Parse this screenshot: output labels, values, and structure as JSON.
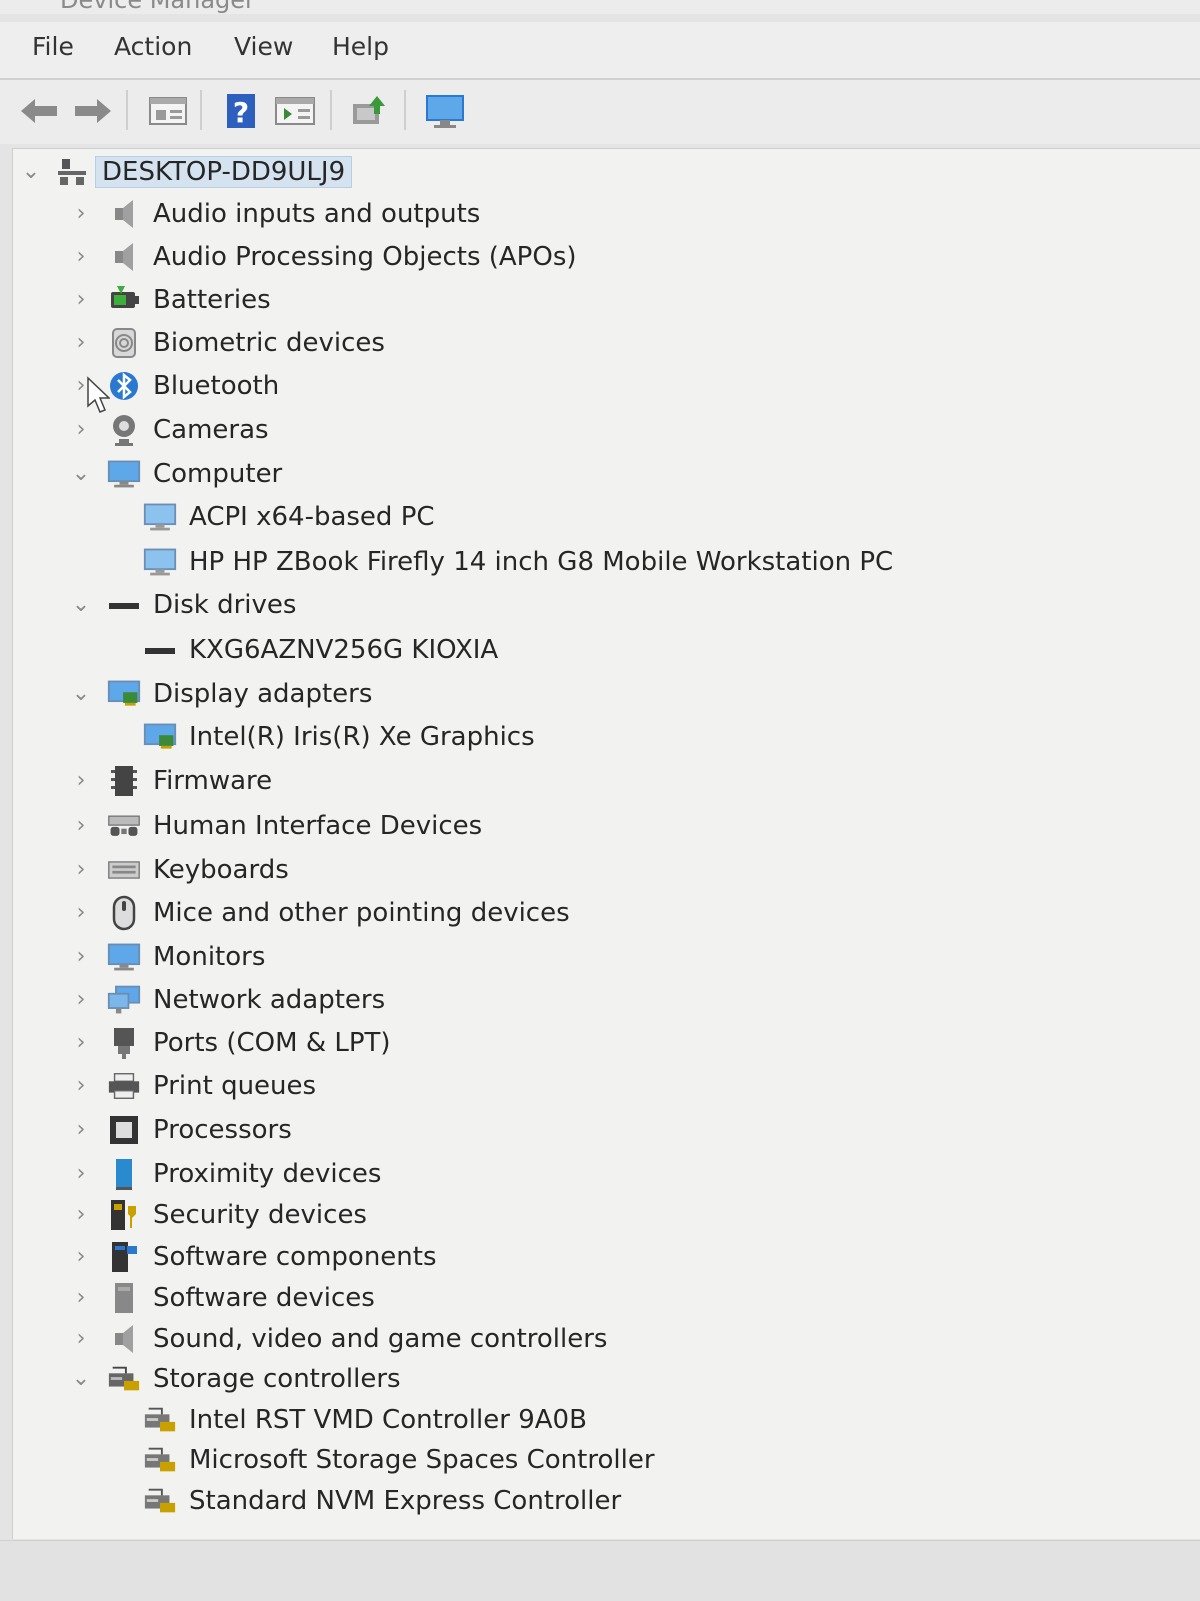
{
  "window": {
    "title": "Device Manager"
  },
  "menu": {
    "file": "File",
    "action": "Action",
    "view": "View",
    "help": "Help"
  },
  "toolbar": {
    "buttons": [
      "back-arrow-icon",
      "forward-arrow-icon",
      "properties-icon",
      "help-icon",
      "view-icon",
      "update-driver-icon",
      "monitor-icon"
    ]
  },
  "tree": {
    "root": "DESKTOP-DD9ULJ9",
    "categories": [
      {
        "label": "Audio inputs and outputs",
        "expanded": false,
        "icon": "speaker-icon"
      },
      {
        "label": "Audio Processing Objects (APOs)",
        "expanded": false,
        "icon": "speaker-icon"
      },
      {
        "label": "Batteries",
        "expanded": false,
        "icon": "battery-icon"
      },
      {
        "label": "Biometric devices",
        "expanded": false,
        "icon": "fingerprint-icon"
      },
      {
        "label": "Bluetooth",
        "expanded": false,
        "icon": "bluetooth-icon"
      },
      {
        "label": "Cameras",
        "expanded": false,
        "icon": "camera-icon"
      },
      {
        "label": "Computer",
        "expanded": true,
        "icon": "computer-icon",
        "children": [
          "ACPI x64-based PC",
          "HP HP ZBook Firefly 14 inch G8 Mobile Workstation PC"
        ]
      },
      {
        "label": "Disk drives",
        "expanded": true,
        "icon": "disk-icon",
        "children": [
          "KXG6AZNV256G KIOXIA"
        ]
      },
      {
        "label": "Display adapters",
        "expanded": true,
        "icon": "display-adapter-icon",
        "children": [
          "Intel(R) Iris(R) Xe Graphics"
        ]
      },
      {
        "label": "Firmware",
        "expanded": false,
        "icon": "firmware-icon"
      },
      {
        "label": "Human Interface Devices",
        "expanded": false,
        "icon": "hid-icon"
      },
      {
        "label": "Keyboards",
        "expanded": false,
        "icon": "keyboard-icon"
      },
      {
        "label": "Mice and other pointing devices",
        "expanded": false,
        "icon": "mouse-icon"
      },
      {
        "label": "Monitors",
        "expanded": false,
        "icon": "monitor-icon"
      },
      {
        "label": "Network adapters",
        "expanded": false,
        "icon": "network-icon"
      },
      {
        "label": "Ports (COM & LPT)",
        "expanded": false,
        "icon": "port-icon"
      },
      {
        "label": "Print queues",
        "expanded": false,
        "icon": "printer-icon"
      },
      {
        "label": "Processors",
        "expanded": false,
        "icon": "processor-icon"
      },
      {
        "label": "Proximity devices",
        "expanded": false,
        "icon": "proximity-icon"
      },
      {
        "label": "Security devices",
        "expanded": false,
        "icon": "security-icon"
      },
      {
        "label": "Software components",
        "expanded": false,
        "icon": "software-component-icon"
      },
      {
        "label": "Software devices",
        "expanded": false,
        "icon": "software-device-icon"
      },
      {
        "label": "Sound, video and game controllers",
        "expanded": false,
        "icon": "speaker-icon"
      },
      {
        "label": "Storage controllers",
        "expanded": true,
        "icon": "storage-controller-icon",
        "children": [
          "Intel RST VMD Controller 9A0B",
          "Microsoft Storage Spaces Controller",
          "Standard NVM Express Controller"
        ]
      }
    ]
  },
  "colors": {
    "selection": "#d5e2f0",
    "pane": "#f2f2f0",
    "accent": "#2a78d0"
  }
}
